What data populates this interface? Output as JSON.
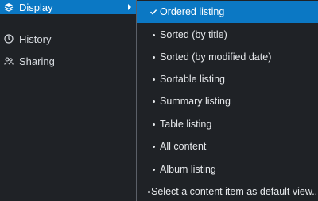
{
  "sidebar": {
    "display_label": "Display",
    "history_label": "History",
    "sharing_label": "Sharing"
  },
  "submenu": {
    "items": [
      {
        "label": "Ordered listing",
        "selected": true
      },
      {
        "label": "Sorted (by title)",
        "selected": false
      },
      {
        "label": "Sorted (by modified date)",
        "selected": false
      },
      {
        "label": "Sortable listing",
        "selected": false
      },
      {
        "label": "Summary listing",
        "selected": false
      },
      {
        "label": "Table listing",
        "selected": false
      },
      {
        "label": "All content",
        "selected": false
      },
      {
        "label": "Album listing",
        "selected": false
      },
      {
        "label": "Select a content item as default view...",
        "selected": false
      }
    ]
  },
  "colors": {
    "background": "#1f2226",
    "accent": "#0b78c4",
    "text": "#e6e8eb"
  }
}
